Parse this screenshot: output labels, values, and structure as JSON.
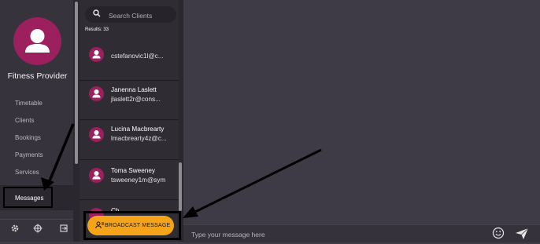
{
  "sidebar": {
    "provider_name": "Fitness Provider",
    "nav": [
      {
        "label": "Timetable"
      },
      {
        "label": "Clients"
      },
      {
        "label": "Bookings"
      },
      {
        "label": "Payments"
      },
      {
        "label": "Services"
      },
      {
        "label": "Messages",
        "active": true
      }
    ],
    "footer_icons": [
      "gear-icon",
      "crosshair-icon",
      "logout-icon"
    ]
  },
  "clients_panel": {
    "search_placeholder": "Search Clients",
    "results_text": "Results: 33",
    "clients": [
      {
        "name": "",
        "email": "cstefanovic1l@c..."
      },
      {
        "name": "Janenna Laslett",
        "email": "jlaslett2r@cons..."
      },
      {
        "name": "Lucina Macbrearty",
        "email": "lmacbrearty4z@c..."
      },
      {
        "name": "Toma Sweeney",
        "email": "tsweeney1m@sym"
      },
      {
        "name": "Ch",
        "email": ""
      }
    ],
    "broadcast_label": "BROADCAST MESSAGE"
  },
  "composer": {
    "placeholder": "Type your message here"
  },
  "colors": {
    "accent": "#9c1f5e",
    "broadcast": "#f5a318",
    "sidebar_bg": "#37333c",
    "list_bg": "#2f2c33",
    "chat_bg": "#3e3a46"
  }
}
